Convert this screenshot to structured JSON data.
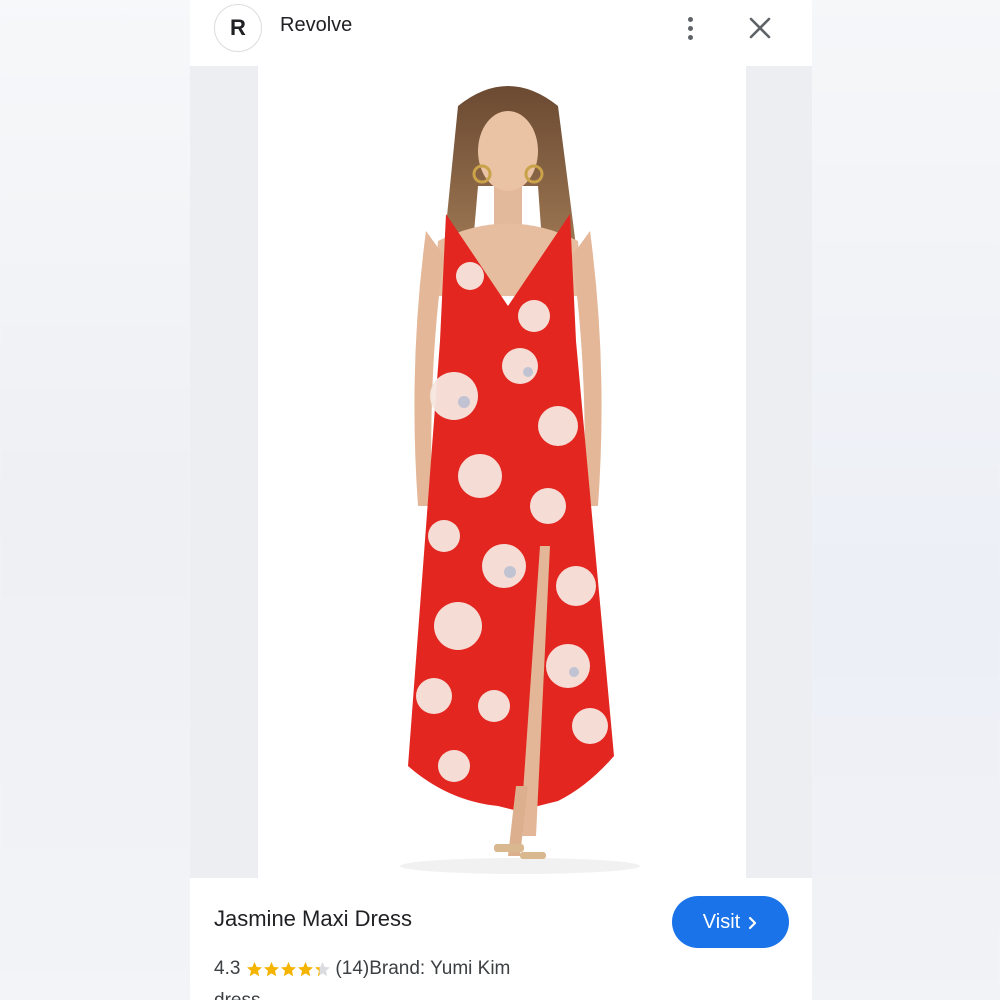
{
  "header": {
    "logo_letter": "R",
    "site_name": "Revolve",
    "more_icon": "more-vert-icon",
    "close_icon": "close-icon"
  },
  "product": {
    "title": "Jasmine Maxi Dress",
    "rating": "4.3",
    "rating_value": 4.3,
    "rating_max": 5,
    "review_count": "(14)",
    "brand": "Brand: Yumi Kim",
    "category_partial": "dress"
  },
  "visit_button": {
    "label": "Visit",
    "icon": "chevron-right-icon",
    "color": "#1a73e8"
  },
  "colors": {
    "dress_red": "#e3261f",
    "star_gold": "#f4b400",
    "star_gray": "#dadce0"
  }
}
